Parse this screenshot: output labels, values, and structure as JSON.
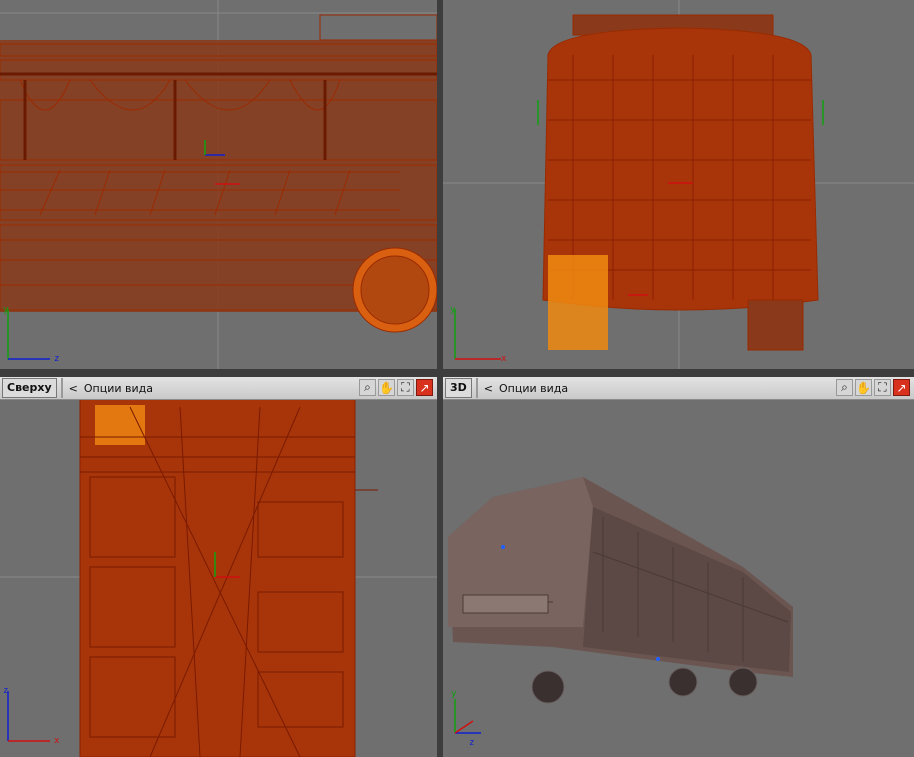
{
  "viewports": {
    "left": {
      "label": "",
      "axes": {
        "vertical": "y",
        "horizontal": "z"
      }
    },
    "front": {
      "label": "",
      "axes": {
        "vertical": "y",
        "horizontal": "x"
      }
    },
    "top": {
      "label": "Сверху",
      "options": "Опции вида",
      "options_arrow": "<",
      "axes": {
        "vertical": "z",
        "horizontal": "x"
      }
    },
    "persp": {
      "label": "3D",
      "options": "Опции вида",
      "options_arrow": "<",
      "axes": {
        "vertical": "y",
        "horizontal": "z"
      }
    }
  },
  "toolbar_icons": [
    "zoom-icon",
    "pan-hand-icon",
    "maximize-icon",
    "close-viewport-icon"
  ],
  "colors": {
    "viewport_bg": "#6f6f6f",
    "wire": "#9a2a00",
    "wire_highlight": "#ff8a10",
    "axis_x": "#d01010",
    "axis_y": "#10a010",
    "axis_z": "#1020d0"
  }
}
